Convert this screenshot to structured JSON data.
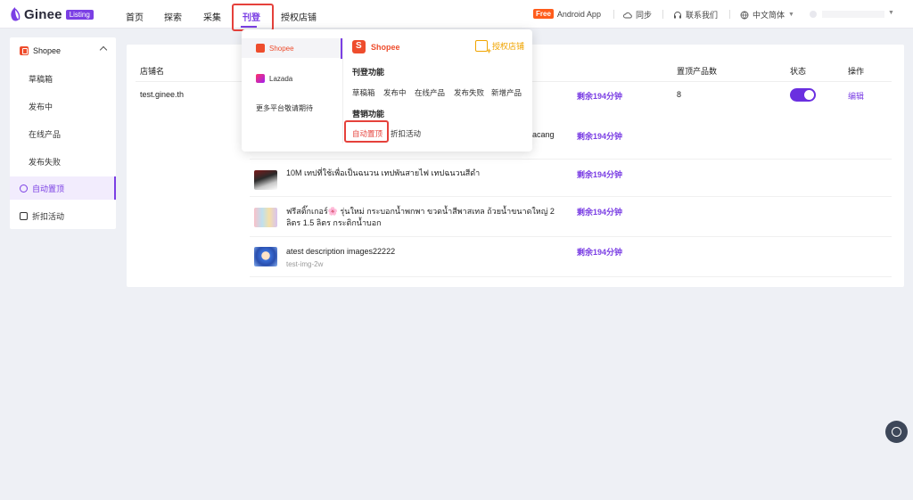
{
  "brand": {
    "name": "Ginee",
    "badge": "Listing",
    "accent": "#7b3fe4"
  },
  "nav": {
    "items": [
      {
        "label": "首页"
      },
      {
        "label": "探索"
      },
      {
        "label": "采集"
      },
      {
        "label": "刊登",
        "active": true
      },
      {
        "label": "授权店铺"
      }
    ],
    "right": {
      "free_badge": "Free",
      "android_app": "Android App",
      "sync": "同步",
      "contact": "联系我们",
      "language": "中文简体"
    }
  },
  "sidebar": {
    "platform": "Shopee",
    "items": [
      {
        "label": "草稿箱"
      },
      {
        "label": "发布中"
      },
      {
        "label": "在线产品"
      },
      {
        "label": "发布失败"
      },
      {
        "label": "自动置顶",
        "active": true
      },
      {
        "label": "折扣活动"
      }
    ]
  },
  "table": {
    "headers": {
      "store": "店铺名",
      "count": "置顶产品数",
      "status": "状态",
      "action": "操作"
    },
    "store_name": "test.ginee.th",
    "count": "8",
    "edit": "编辑",
    "remaining": "剩余194分钟",
    "row2_tail": "acang",
    "products": [
      {
        "name": "10M เทปที่ใช้เพื่อเป็นฉนวน เทปพันสายไฟ เทปฉนวนสีดำ",
        "sku": ""
      },
      {
        "name": "ฟรีสติ๊กเกอร์🌸 รุ่นใหม่ กระบอกน้ำพกพา ขวดน้ำสีพาสเทล ถ้วยน้ำขนาดใหญ่ 2 ลิตร 1.5 ลิตร กระติกน้ำบอก",
        "sku": ""
      },
      {
        "name": "atest description images22222",
        "sku": "test-img-2w"
      }
    ]
  },
  "dropdown": {
    "platforms": [
      {
        "label": "Shopee",
        "active": true
      },
      {
        "label": "Lazada"
      },
      {
        "label": "更多平台敬请期待"
      }
    ],
    "header": "Shopee",
    "auth_link": "授权店铺",
    "publish_title": "刊登功能",
    "publish_links": [
      "草稿箱",
      "发布中",
      "在线产品",
      "发布失败",
      "新增产品"
    ],
    "marketing_title": "营销功能",
    "marketing_links": [
      {
        "label": "自动置顶",
        "active": true
      },
      {
        "label": "折扣活动"
      }
    ]
  }
}
